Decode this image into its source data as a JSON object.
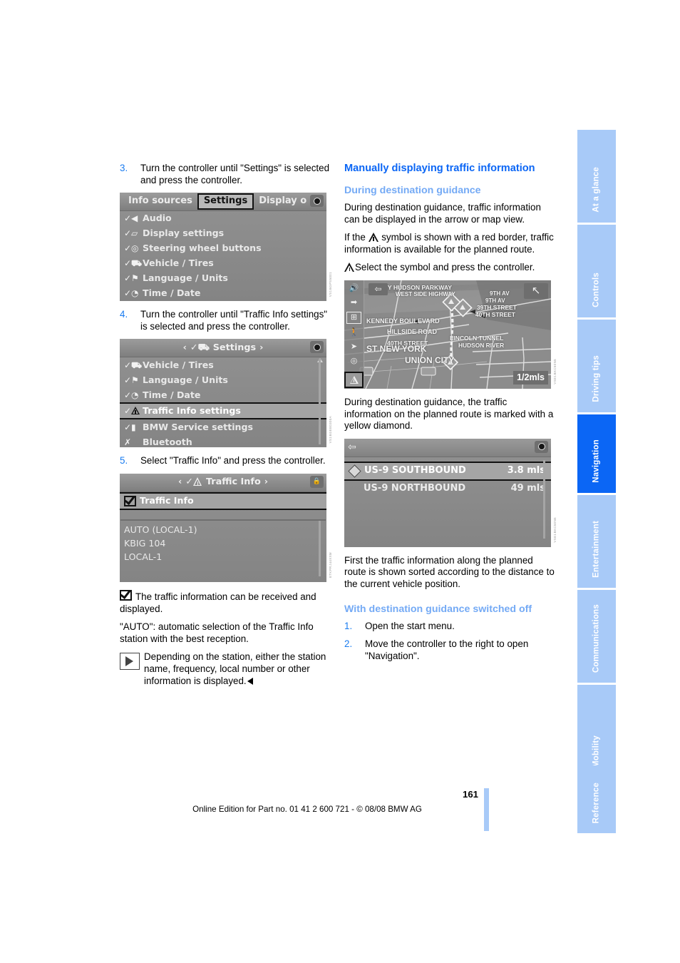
{
  "page": {
    "number": "161",
    "footer": "Online Edition for Part no. 01 41 2 600 721 - © 08/08 BMW AG"
  },
  "side_tabs": [
    {
      "label": "At a glance",
      "active": false
    },
    {
      "label": "Controls",
      "active": false
    },
    {
      "label": "Driving tips",
      "active": false
    },
    {
      "label": "Navigation",
      "active": true
    },
    {
      "label": "Entertainment",
      "active": false
    },
    {
      "label": "Communications",
      "active": false
    },
    {
      "label": "Mobility",
      "active": false
    },
    {
      "label": "Reference",
      "active": false
    }
  ],
  "colors": {
    "accent_blue": "#0b66f5",
    "light_blue": "#74aaf5",
    "tab_inactive": "#a8caf8",
    "step_number": "#1a7cf0"
  },
  "left_column": {
    "step3": {
      "number": "3.",
      "text": "Turn the controller until \"Settings\" is selected and press the controller."
    },
    "figure_settings_tabs": {
      "fig_id": "VS1\u0002BGPS5001",
      "tabs": [
        {
          "label": "Info sources",
          "selected": false
        },
        {
          "label": "Settings",
          "selected": true
        },
        {
          "label": "Display o",
          "selected": false
        }
      ],
      "rows": [
        "Audio",
        "Display settings",
        "Steering wheel buttons",
        "Vehicle / Tires",
        "Language / Units",
        "Time / Date"
      ]
    },
    "step4": {
      "number": "4.",
      "text": "Turn the controller until \"Traffic Info settings\" is selected and press the controller."
    },
    "figure_settings_menu": {
      "fig_id": "VS1\u0002BGEE0300A",
      "title": "Settings",
      "rows": [
        {
          "label": "Vehicle / Tires",
          "selected": false
        },
        {
          "label": "Language / Units",
          "selected": false
        },
        {
          "label": "Time / Date",
          "selected": false
        },
        {
          "label": "Traffic Info settings",
          "selected": true
        },
        {
          "label": "BMW Service settings",
          "selected": false
        },
        {
          "label": "Bluetooth",
          "selected": false
        }
      ]
    },
    "step5": {
      "number": "5.",
      "text": "Select \"Traffic Info\" and press the controller."
    },
    "figure_traffic_info": {
      "fig_id": "ETKPR\u0002J44XXM",
      "title": "Traffic Info",
      "checkbox_row": "Traffic Info",
      "stations": [
        "AUTO (LOCAL-1)",
        "KBIG 104",
        "LOCAL-1"
      ]
    },
    "note_checkbox": "The traffic information can be received and displayed.",
    "note_auto": "\"AUTO\": automatic selection of the Traffic Info station with the best reception.",
    "note_play": "Depending on the station, either the station name, frequency, local number or other information is displayed."
  },
  "right_column": {
    "heading": "Manually displaying traffic information",
    "subheading_during": "During destination guidance",
    "para1": "During destination guidance, traffic information can be displayed in the arrow or map view.",
    "para2_before": "If the ",
    "para2_after": " symbol is shown with a red border, traffic information is available for the planned route.",
    "bullet_select": "Select the symbol and press the controller.",
    "figure_map": {
      "fig_id": "VSE1\u0002BKC50N5",
      "scale": "1/2mls",
      "labels": [
        "RY HUDSON PARKWAY",
        "WEST SIDE HIGHWAY",
        "9TH AV",
        "9TH AV",
        "39TH STREET",
        "40TH STREET",
        "KENNEDY BOULEVARD",
        "HILLSIDE ROAD",
        "40TH STREET",
        "LINCOLN TUNNEL",
        "HUDSON RIVER",
        "ST NEW YORK",
        "UNION CITY"
      ],
      "icons": [
        "volume-icon",
        "route-arrow-icon",
        "split-screen-icon",
        "pedestrian-icon",
        "navigation-arrow-icon",
        "compass-icon",
        "traffic-warning-icon"
      ]
    },
    "para3": "During destination guidance, the traffic information on the planned route is marked with a yellow diamond.",
    "figure_traffic_list": {
      "fig_id": "VSE1\u0002BKC50N6",
      "rows": [
        {
          "name": "US-9 SOUTHBOUND",
          "distance": "3.8 mls",
          "selected": true
        },
        {
          "name": "US-9 NORTHBOUND",
          "distance": "49 mls",
          "selected": false
        }
      ]
    },
    "para4": "First the traffic information along the planned route is shown sorted according to the distance to the current vehicle position.",
    "subheading_off": "With destination guidance switched off",
    "step1": {
      "number": "1.",
      "text": "Open the start menu."
    },
    "step2": {
      "number": "2.",
      "text": "Move the controller to the right to open \"Navigation\"."
    }
  }
}
